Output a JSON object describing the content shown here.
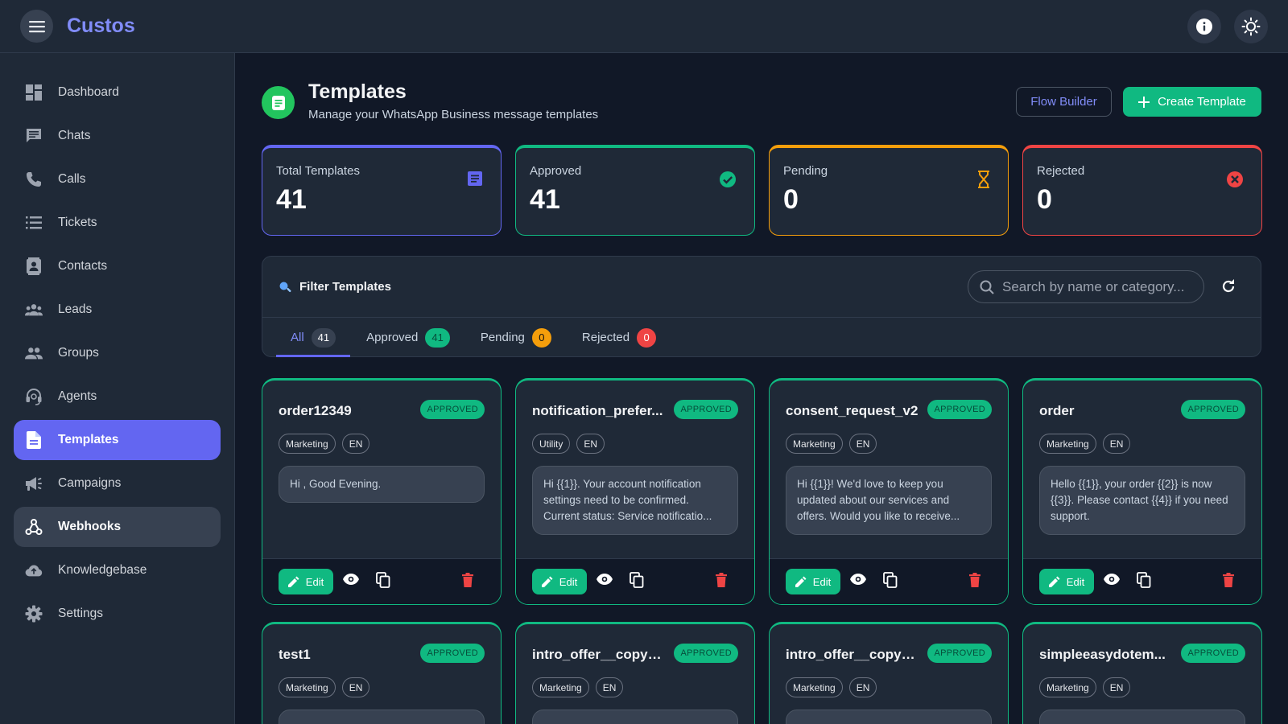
{
  "app": {
    "brand": "Custos"
  },
  "sidebar": {
    "items": [
      {
        "label": "Dashboard",
        "icon": "dashboard-icon"
      },
      {
        "label": "Chats",
        "icon": "chat-icon"
      },
      {
        "label": "Calls",
        "icon": "phone-icon"
      },
      {
        "label": "Tickets",
        "icon": "list-icon"
      },
      {
        "label": "Contacts",
        "icon": "contacts-icon"
      },
      {
        "label": "Leads",
        "icon": "people-icon"
      },
      {
        "label": "Groups",
        "icon": "group-icon"
      },
      {
        "label": "Agents",
        "icon": "headset-icon"
      },
      {
        "label": "Templates",
        "icon": "document-icon"
      },
      {
        "label": "Campaigns",
        "icon": "megaphone-icon"
      },
      {
        "label": "Webhooks",
        "icon": "webhook-icon"
      },
      {
        "label": "Knowledgebase",
        "icon": "cloud-icon"
      },
      {
        "label": "Settings",
        "icon": "gear-icon"
      }
    ],
    "active": "Templates",
    "highlighted": "Webhooks"
  },
  "header": {
    "title": "Templates",
    "subtitle": "Manage your WhatsApp Business message templates",
    "flow_builder": "Flow Builder",
    "create_template": "Create Template"
  },
  "stats": [
    {
      "label": "Total Templates",
      "value": "41",
      "color": "#6366f1"
    },
    {
      "label": "Approved",
      "value": "41",
      "color": "#10b981"
    },
    {
      "label": "Pending",
      "value": "0",
      "color": "#f59e0b"
    },
    {
      "label": "Rejected",
      "value": "0",
      "color": "#ef4444"
    }
  ],
  "filter": {
    "title": "Filter Templates",
    "search_placeholder": "Search by name or category...",
    "tabs": [
      {
        "label": "All",
        "count": "41"
      },
      {
        "label": "Approved",
        "count": "41"
      },
      {
        "label": "Pending",
        "count": "0"
      },
      {
        "label": "Rejected",
        "count": "0"
      }
    ]
  },
  "cards": [
    {
      "name": "order12349",
      "status": "APPROVED",
      "category": "Marketing",
      "lang": "EN",
      "body": "Hi , Good Evening."
    },
    {
      "name": "notification_prefer...",
      "status": "APPROVED",
      "category": "Utility",
      "lang": "EN",
      "body": "Hi {{1}}. Your account notification settings need to be confirmed. Current status: Service notificatio..."
    },
    {
      "name": "consent_request_v2",
      "status": "APPROVED",
      "category": "Marketing",
      "lang": "EN",
      "body": "Hi {{1}}! We'd love to keep you updated about our services and offers. Would you like to receive..."
    },
    {
      "name": "order",
      "status": "APPROVED",
      "category": "Marketing",
      "lang": "EN",
      "body": "Hello {{1}}, your order {{2}} is now {{3}}. Please contact {{4}} if you need support."
    },
    {
      "name": "test1",
      "status": "APPROVED",
      "category": "Marketing",
      "lang": "EN"
    },
    {
      "name": "intro_offer__copy_1...",
      "status": "APPROVED",
      "category": "Marketing",
      "lang": "EN"
    },
    {
      "name": "intro_offer__copy_1...",
      "status": "APPROVED",
      "category": "Marketing",
      "lang": "EN"
    },
    {
      "name": "simpleeasydotem...",
      "status": "APPROVED",
      "category": "Marketing",
      "lang": "EN"
    }
  ],
  "card_actions": {
    "edit": "Edit"
  }
}
